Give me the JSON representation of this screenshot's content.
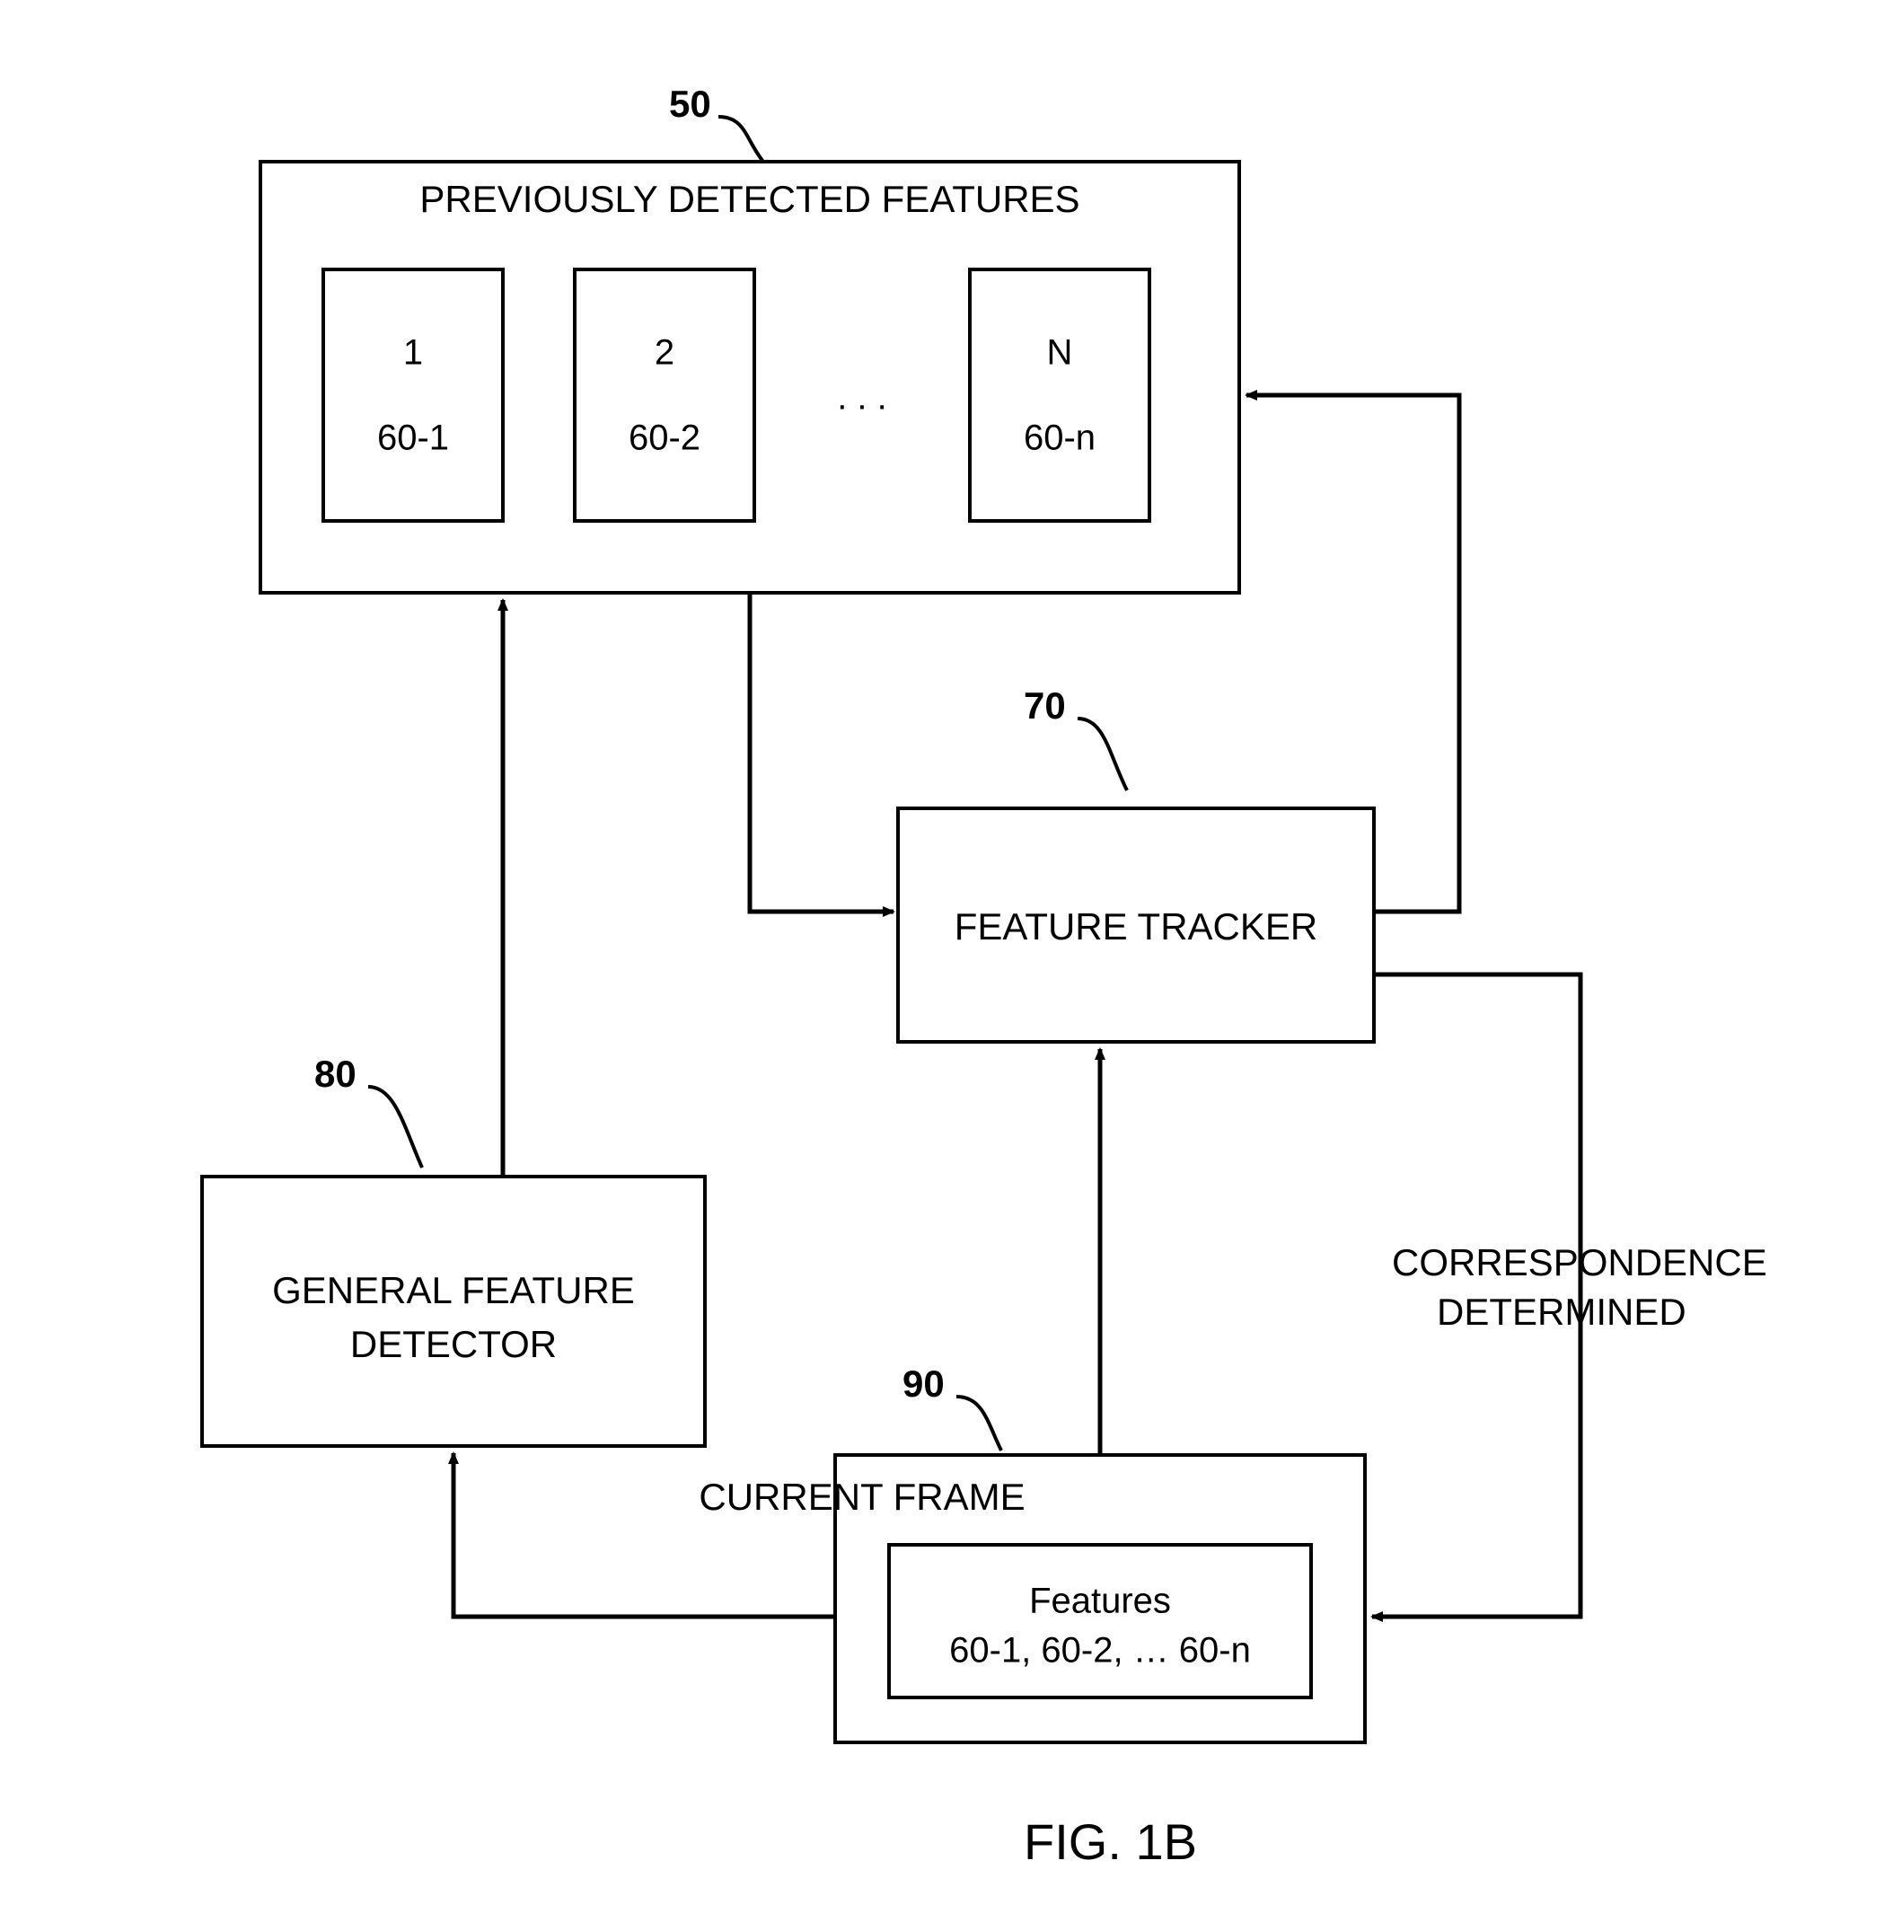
{
  "figure_label": "FIG. 1B",
  "refs": {
    "prev_features": "50",
    "tracker": "70",
    "detector": "80",
    "current_frame": "90"
  },
  "boxes": {
    "prev_features_title": "PREVIOUSLY DETECTED FEATURES",
    "feature1_num": "1",
    "feature1_ref": "60-1",
    "feature2_num": "2",
    "feature2_ref": "60-2",
    "ellipsis": ". . .",
    "featureN_num": "N",
    "featureN_ref": "60-n",
    "tracker": "FEATURE TRACKER",
    "detector_line1": "GENERAL FEATURE",
    "detector_line2": "DETECTOR",
    "current_frame_title": "CURRENT FRAME",
    "features_line1": "Features",
    "features_line2": "60-1, 60-2, … 60-n"
  },
  "annotations": {
    "correspondence_line1": "CORRESPONDENCE",
    "correspondence_line2": "DETERMINED"
  }
}
